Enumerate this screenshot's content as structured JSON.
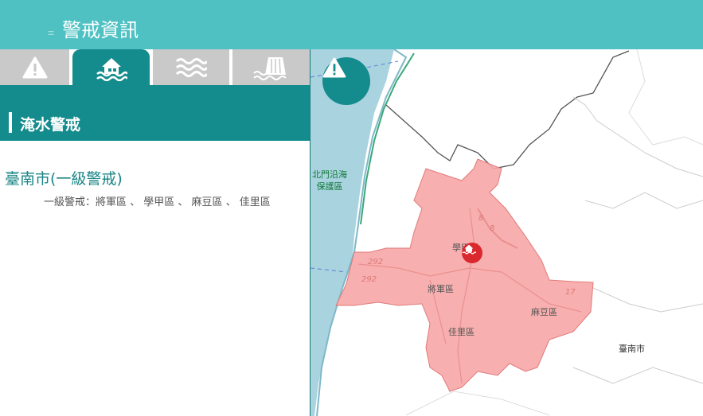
{
  "header": {
    "dots": ":::",
    "title": "警戒資訊"
  },
  "tabs": [
    {
      "icon": "warning-icon",
      "active": false
    },
    {
      "icon": "flooded-house-icon",
      "active": true
    },
    {
      "icon": "waves-icon",
      "active": false
    },
    {
      "icon": "dam-icon",
      "active": false
    }
  ],
  "section": {
    "title": "淹水警戒"
  },
  "alert": {
    "city": "臺南市(一級警戒)",
    "detail": "一級警戒：將軍區 、 學甲區 、 麻豆區 、 佳里區"
  },
  "map": {
    "reserve_label": [
      "北門沿海",
      "保護區"
    ],
    "district_labels": [
      "學甲區",
      "將軍區",
      "麻豆區",
      "佳里區"
    ],
    "city_label": "臺南市",
    "road_labels": [
      "8",
      "8",
      "292",
      "292",
      "17"
    ],
    "colors": {
      "sea": "#a9d3df",
      "alert_fill": "#f7a6a6",
      "alert_stroke": "#e07a7a",
      "teal": "#148b8c"
    }
  }
}
